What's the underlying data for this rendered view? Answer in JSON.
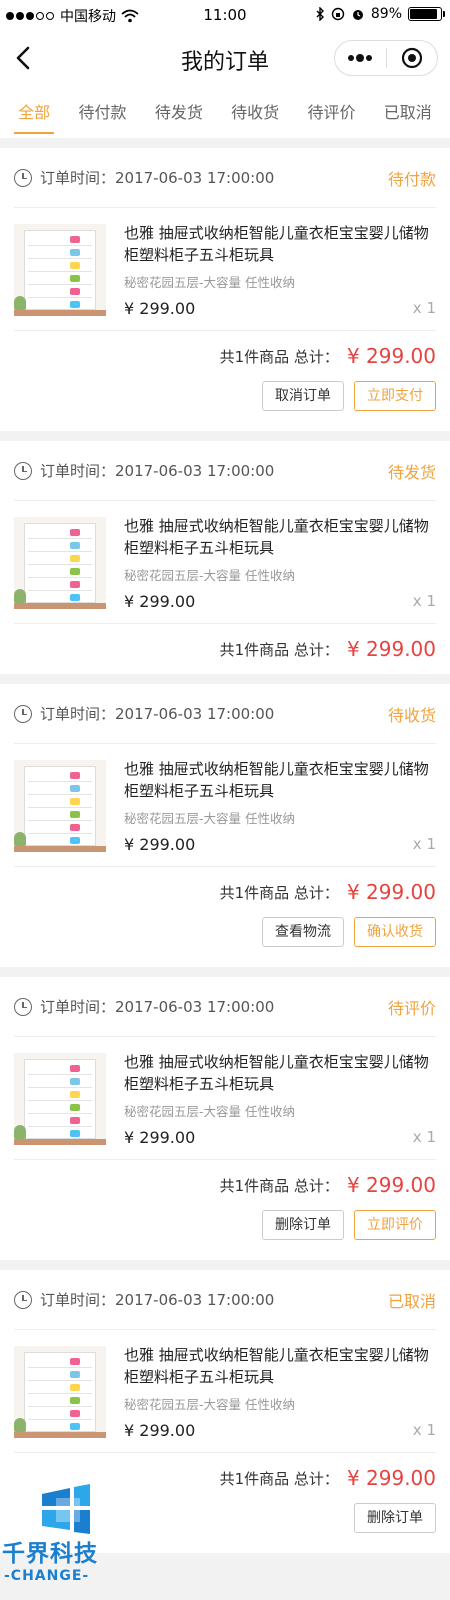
{
  "statusbar": {
    "carrier": "中国移动",
    "time": "11:00",
    "battery": "89%",
    "battery_level": 0.89
  },
  "nav": {
    "title": "我的订单",
    "back_icon": "chevron-left-icon",
    "more_icon": "more-icon",
    "close_icon": "target-icon"
  },
  "tabs": [
    {
      "label": "全部",
      "active": true
    },
    {
      "label": "待付款"
    },
    {
      "label": "待发货"
    },
    {
      "label": "待收货"
    },
    {
      "label": "待评价"
    },
    {
      "label": "已取消"
    }
  ],
  "colors": {
    "accent": "#f1a33f",
    "price_red": "#e64340"
  },
  "orders": [
    {
      "time": "订单时间：2017-06-03 17:00:00",
      "status": "待付款",
      "name": "也雅 抽屉式收纳柜智能儿童衣柜宝宝婴儿储物柜塑料柜子五斗柜玩具",
      "spec": "秘密花园五层-大容量 任性收纳",
      "price": "¥ 299.00",
      "qty": "x 1",
      "summary_label": "共1件商品 总计：",
      "total": "¥ 299.00",
      "buttons": [
        "取消订单",
        "立即支付"
      ]
    },
    {
      "time": "订单时间：2017-06-03 17:00:00",
      "status": "待发货",
      "name": "也雅 抽屉式收纳柜智能儿童衣柜宝宝婴儿储物柜塑料柜子五斗柜玩具",
      "spec": "秘密花园五层-大容量 任性收纳",
      "price": "¥ 299.00",
      "qty": "x 1",
      "summary_label": "共1件商品 总计：",
      "total": "¥ 299.00",
      "buttons": []
    },
    {
      "time": "订单时间：2017-06-03 17:00:00",
      "status": "待收货",
      "name": "也雅 抽屉式收纳柜智能儿童衣柜宝宝婴儿储物柜塑料柜子五斗柜玩具",
      "spec": "秘密花园五层-大容量 任性收纳",
      "price": "¥ 299.00",
      "qty": "x 1",
      "summary_label": "共1件商品 总计：",
      "total": "¥ 299.00",
      "buttons": [
        "查看物流",
        "确认收货"
      ]
    },
    {
      "time": "订单时间：2017-06-03 17:00:00",
      "status": "待评价",
      "name": "也雅 抽屉式收纳柜智能儿童衣柜宝宝婴儿储物柜塑料柜子五斗柜玩具",
      "spec": "秘密花园五层-大容量 任性收纳",
      "price": "¥ 299.00",
      "qty": "x 1",
      "summary_label": "共1件商品 总计：",
      "total": "¥ 299.00",
      "buttons": [
        "删除订单",
        "立即评价"
      ]
    },
    {
      "time": "订单时间：2017-06-03 17:00:00",
      "status": "已取消",
      "name": "也雅 抽屉式收纳柜智能儿童衣柜宝宝婴儿储物柜塑料柜子五斗柜玩具",
      "spec": "秘密花园五层-大容量 任性收纳",
      "price": "¥ 299.00",
      "qty": "x 1",
      "summary_label": "共1件商品 总计：",
      "total": "¥ 299.00",
      "buttons": [
        "删除订单"
      ]
    }
  ],
  "watermark": {
    "text": "千界科技",
    "sub": "-CHANGE-"
  }
}
